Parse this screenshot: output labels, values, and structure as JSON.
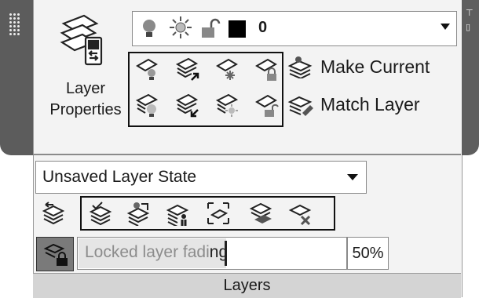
{
  "panel": {
    "title": "Layers"
  },
  "layer_properties": {
    "label": "Layer\nProperties",
    "icon": "layer-properties-icon"
  },
  "layer_dropdown": {
    "current_layer": "0",
    "color": "#000000",
    "icons": [
      "lightbulb-icon",
      "sun-icon",
      "unlocked-padlock-icon"
    ]
  },
  "tools_row1": [
    "layer-off-icon",
    "layer-isolate-icon",
    "layer-freeze-icon",
    "layer-lock-icon"
  ],
  "tools_row2": [
    "layer-on-icon",
    "layer-unisolate-icon",
    "layer-thaw-icon",
    "layer-unlock-icon"
  ],
  "buttons": {
    "make_current": "Make Current",
    "match_layer": "Match Layer"
  },
  "layer_state": {
    "value": "Unsaved Layer State"
  },
  "state_tools": [
    "previous-layer-icon",
    "change-to-current-icon",
    "copy-objects-to-layer-icon",
    "layer-walk-icon",
    "isolate-to-viewport-icon",
    "merge-layers-icon",
    "delete-layer-icon"
  ],
  "fading": {
    "tooltip": "Locked layer fadi",
    "suffix": "ng",
    "value": "50%",
    "toggle_icon": "locked-layer-fading-icon"
  }
}
